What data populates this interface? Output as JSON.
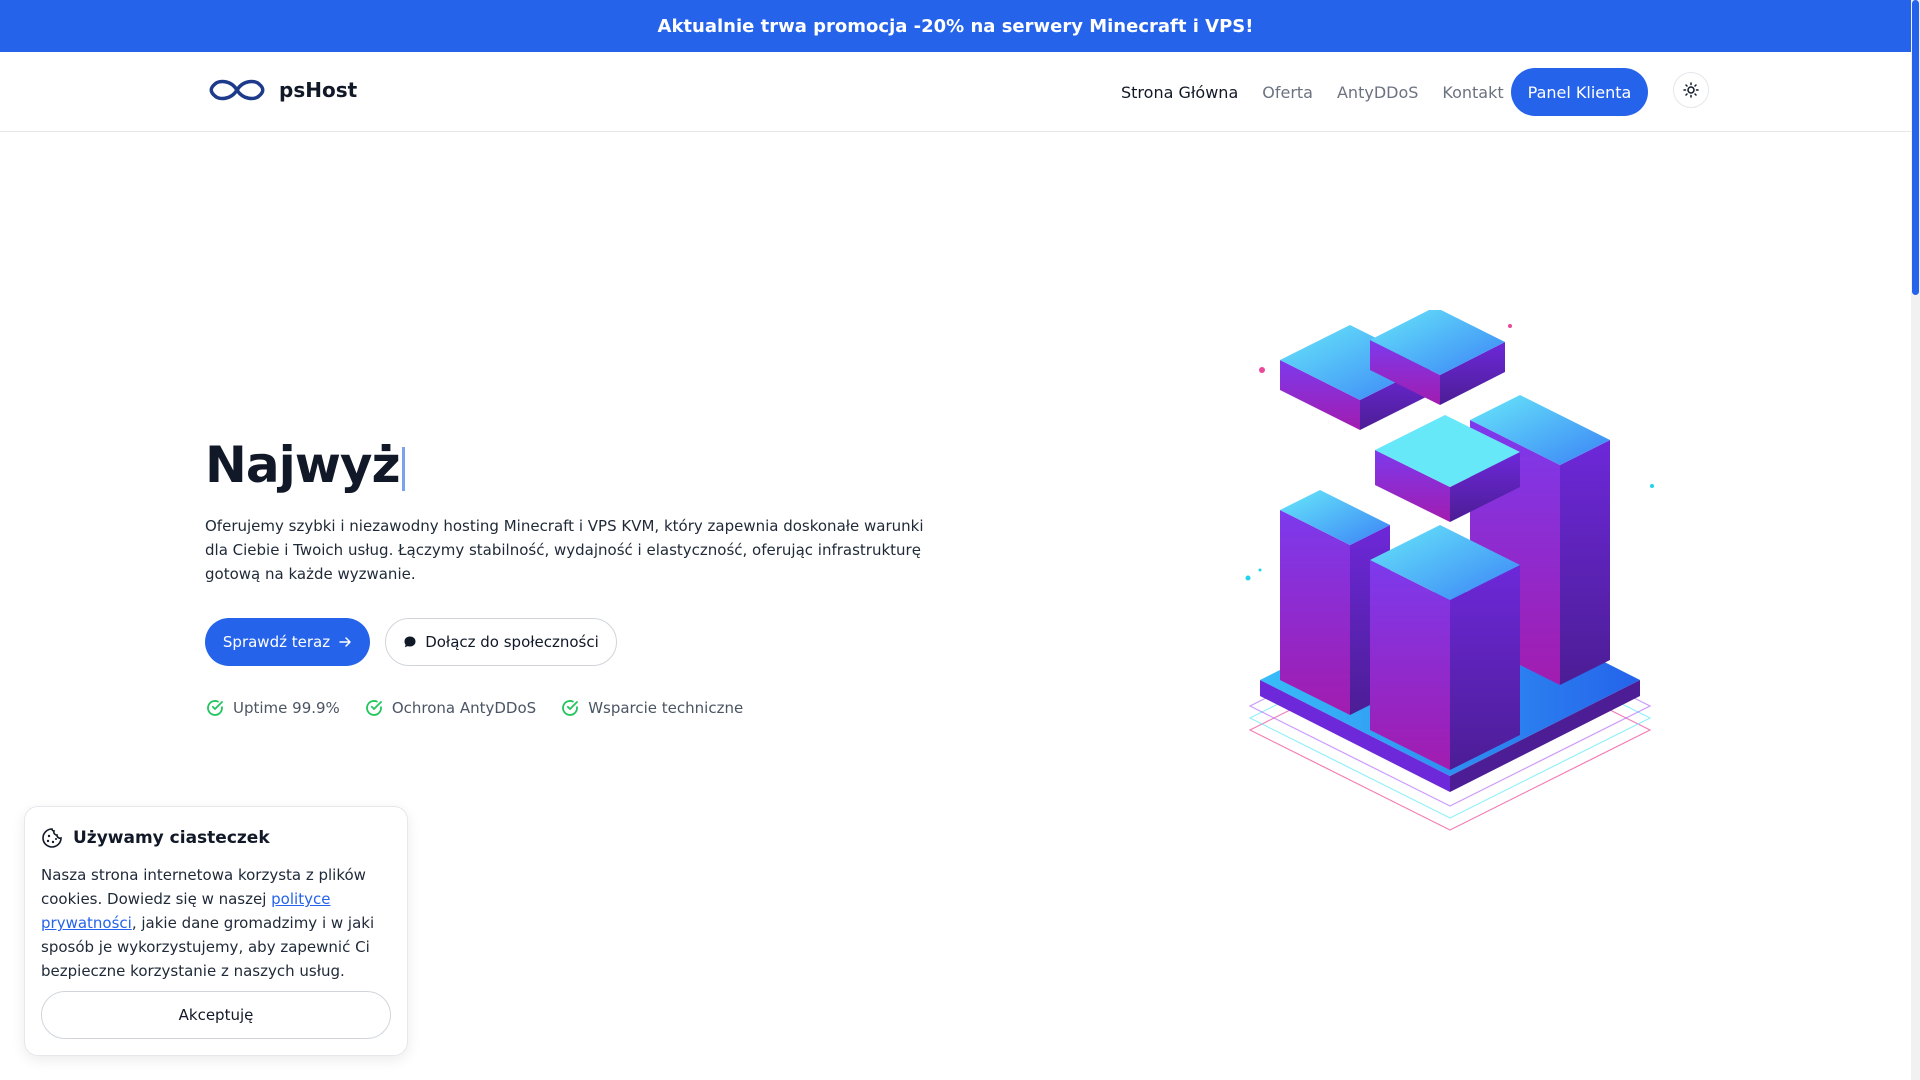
{
  "promo": {
    "text": "Aktualnie trwa promocja -20% na serwery Minecraft i VPS!"
  },
  "header": {
    "brand": "psHost",
    "nav": [
      {
        "label": "Strona Główna",
        "active": true
      },
      {
        "label": "Oferta",
        "active": false
      },
      {
        "label": "AntyDDoS",
        "active": false
      },
      {
        "label": "Kontakt",
        "active": false
      }
    ],
    "panel_label": "Panel Klienta"
  },
  "hero": {
    "title_typed": "Najwyż",
    "description": "Oferujemy szybki i niezawodny hosting Minecraft i VPS KVM, który zapewnia doskonałe warunki dla Ciebie i Twoich usług. Łączymy stabilność, wydajność i elastyczność, oferując infrastrukturę gotową na każde wyzwanie.",
    "cta_primary": "Sprawdź teraz",
    "cta_secondary": "Dołącz do społeczności",
    "features": [
      "Uptime 99.9%",
      "Ochrona AntyDDoS",
      "Wsparcie techniczne"
    ]
  },
  "cookie": {
    "title": "Używamy ciasteczek",
    "text_before": "Nasza strona internetowa korzysta z plików cookies. Dowiedz się w naszej ",
    "link": "polityce prywatności",
    "text_after": ", jakie dane gromadzimy i w jaki sposób je wykorzystujemy, aby zapewnić Ci bezpieczne korzystanie z naszych usług.",
    "accept_label": "Akceptuję"
  },
  "colors": {
    "accent": "#2563eb",
    "success": "#22c55e",
    "text": "#111827"
  },
  "icons": [
    "infinity-logo-icon",
    "sun-icon",
    "arrow-right-icon",
    "chat-icon",
    "check-circle-icon",
    "cookie-icon"
  ]
}
